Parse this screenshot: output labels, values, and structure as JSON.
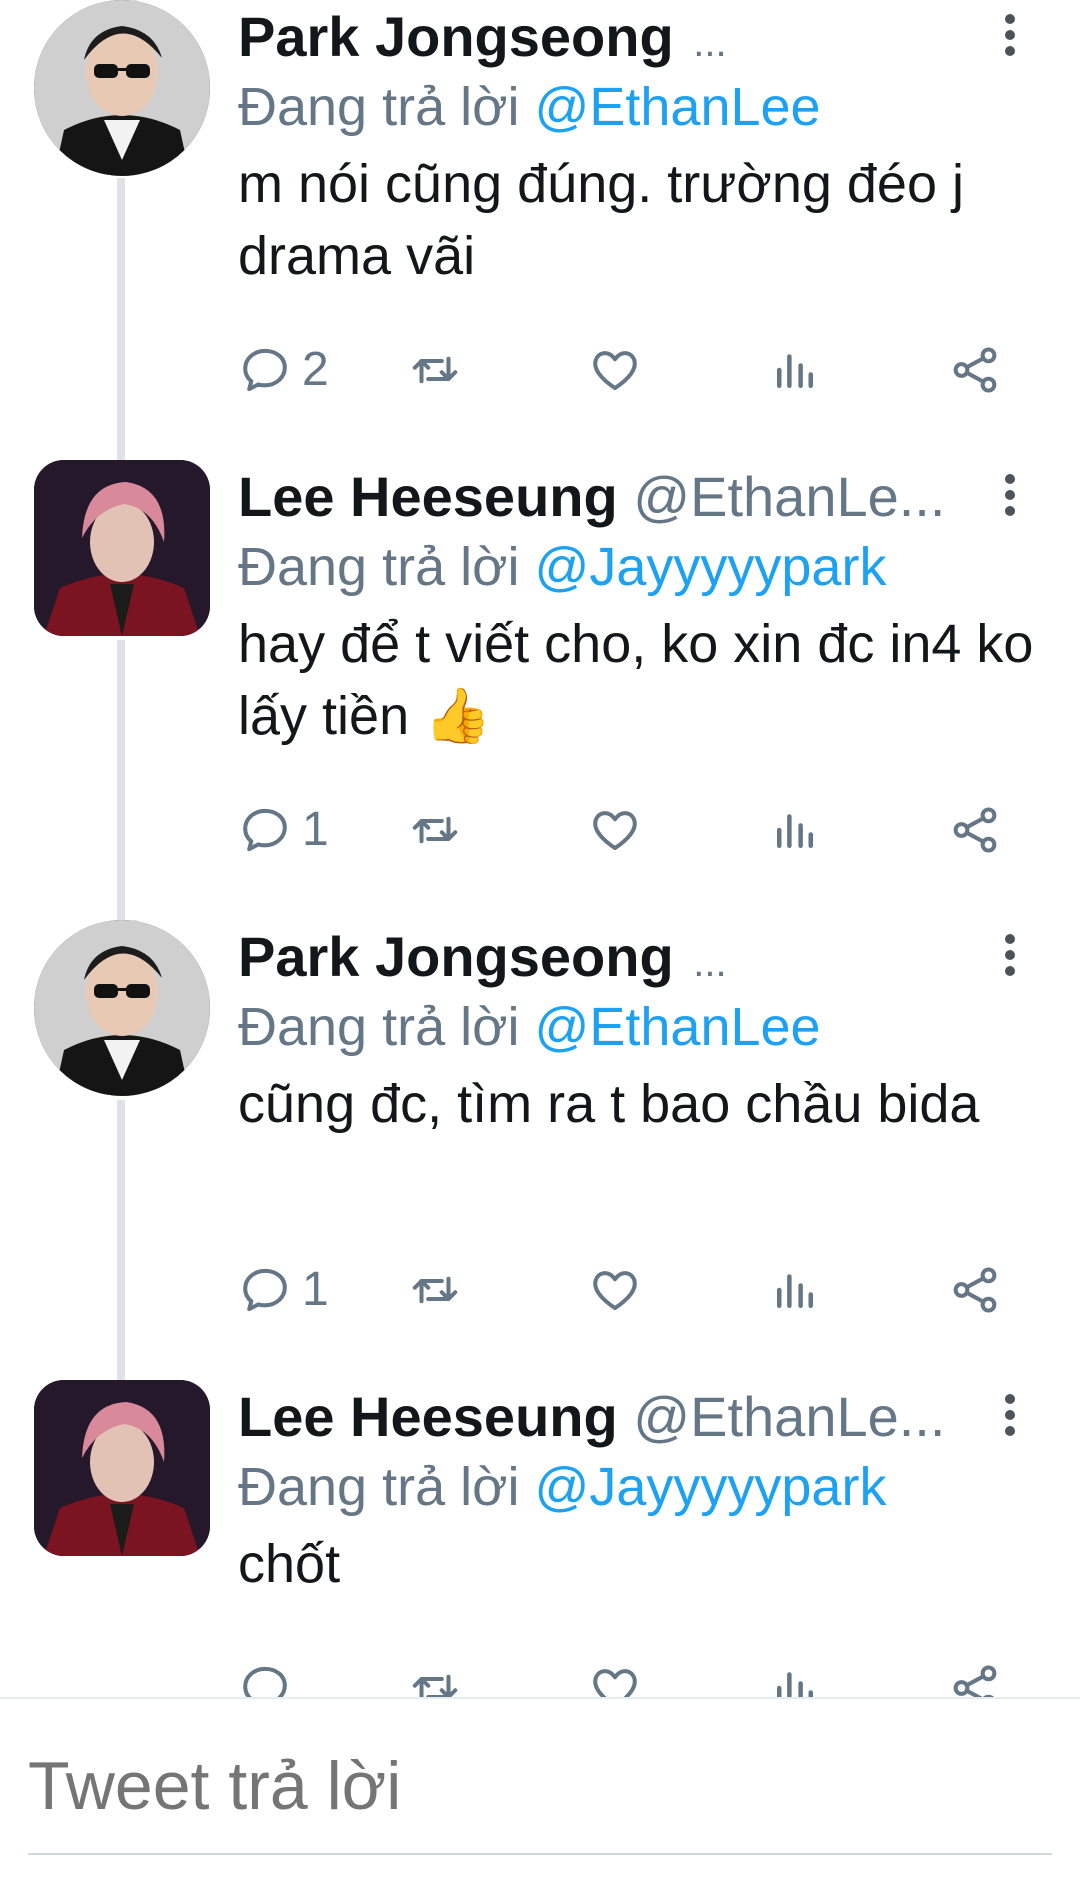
{
  "tweets": [
    {
      "name": "Park Jongseong",
      "handle": "",
      "ellipsis": "...",
      "reply_prefix": "Đang trả lời",
      "reply_handle": "@EthanLee",
      "text": "m nói cũng đúng. trường đéo j drama vãi",
      "reply_count": "2",
      "avatar": "park-jongseong-avatar"
    },
    {
      "name": "Lee Heeseung",
      "handle": "@EthanLe...",
      "ellipsis": "",
      "reply_prefix": "Đang trả lời",
      "reply_handle": "@Jayyyyypark",
      "text": "hay để t viết cho, ko xin đc in4 ko lấy tiền",
      "emoji": "👍",
      "reply_count": "1",
      "avatar": "lee-heeseung-avatar"
    },
    {
      "name": "Park Jongseong",
      "handle": "",
      "ellipsis": "...",
      "reply_prefix": "Đang trả lời",
      "reply_handle": "@EthanLee",
      "text": "cũng đc, tìm ra t bao chầu bida",
      "reply_count": "1",
      "avatar": "park-jongseong-avatar"
    },
    {
      "name": "Lee Heeseung",
      "handle": "@EthanLe...",
      "ellipsis": "",
      "reply_prefix": "Đang trả lời",
      "reply_handle": "@Jayyyyypark",
      "text": "chốt",
      "reply_count": "",
      "avatar": "lee-heeseung-avatar"
    }
  ],
  "composer": {
    "placeholder": "Tweet trả lời"
  },
  "icons": [
    "reply-icon",
    "retweet-icon",
    "like-icon",
    "stats-icon",
    "share-icon",
    "more-icon"
  ],
  "colors": {
    "link": "#1da1f2",
    "muted": "#657786",
    "text": "#14171a",
    "thread": "#dfe3e7"
  }
}
